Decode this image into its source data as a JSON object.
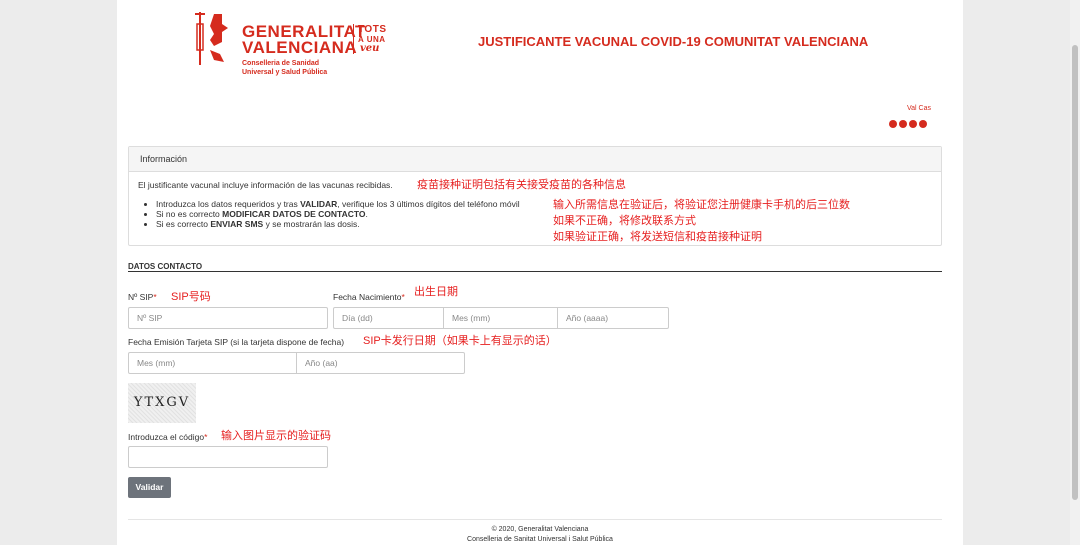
{
  "header": {
    "logo_line1": "GENERALITAT",
    "logo_line2": "VALENCIANA",
    "logo_tots1": "TOTS",
    "logo_tots2": "A UNA",
    "logo_tots3": "veu",
    "logo_sub1": "Conselleria de Sanidad",
    "logo_sub2": "Universal y Salud Pública",
    "title": "JUSTIFICANTE VACUNAL COVID-19 COMUNITAT VALENCIANA",
    "lang_switch": "Val Cas",
    "social_icons": [
      "twitter-icon",
      "youtube-icon",
      "facebook-icon",
      "flickr-icon"
    ],
    "accent_color": "#d52b1e"
  },
  "info": {
    "header": "Información",
    "intro": "El justificante vacunal incluye información de las vacunas recibidas.",
    "items": [
      {
        "pre": "Introduzca los datos requeridos y tras ",
        "bold": "VALIDAR",
        "post": ", verifique los 3 últimos dígitos del teléfono móvil"
      },
      {
        "pre": "Si no es correcto ",
        "bold": "MODIFICAR DATOS DE CONTACTO",
        "post": "."
      },
      {
        "pre": "Si es correcto ",
        "bold": "ENVIAR SMS",
        "post": " y se mostrarán las dosis."
      }
    ]
  },
  "annotations": {
    "intro_note": "疫苗接种证明包括有关接受疫苗的各种信息",
    "steps_note1": "输入所需信息在验证后，将验证您注册健康卡手机的后三位数",
    "steps_note2": "如果不正确，将修改联系方式",
    "steps_note3": "如果验证正确，将发送短信和疫苗接种证明",
    "sip_note": "SIP号码",
    "birth_note": "出生日期",
    "card_note": "SIP卡发行日期（如果卡上有显示的话）",
    "code_note": "输入图片显示的验证码"
  },
  "form": {
    "section_title": "DATOS CONTACTO",
    "sip_label": "Nº SIP",
    "sip_placeholder": "Nº SIP",
    "birth_label": "Fecha Nacimiento",
    "birth_day_placeholder": "Día (dd)",
    "birth_month_placeholder": "Mes (mm)",
    "birth_year_placeholder": "Año (aaaa)",
    "card_label": "Fecha Emisión Tarjeta SIP (si la tarjeta dispone de fecha)",
    "card_month_placeholder": "Mes (mm)",
    "card_year_placeholder": "Año (aa)",
    "captcha_text": "YTXGV",
    "code_label": "Introduzca el código",
    "code_value": "",
    "required_mark": "*",
    "submit_label": "Validar"
  },
  "footer": {
    "line1": "© 2020, Generalitat Valenciana",
    "line2": "Conselleria de Sanitat Universal i Salut Pública"
  }
}
